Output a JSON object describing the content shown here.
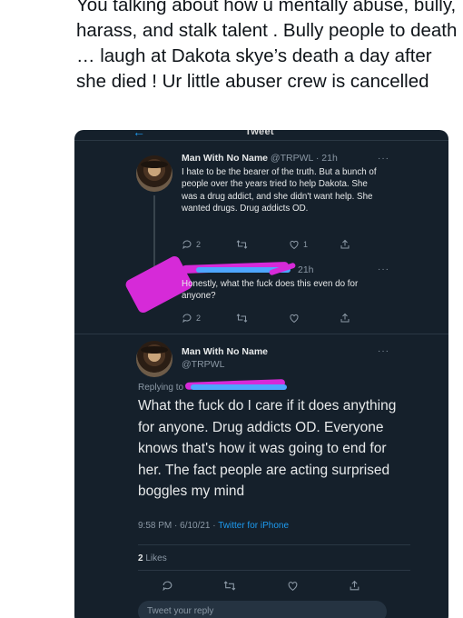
{
  "caption": {
    "text": "You talking about how u mentally abuse, bully, harass, and stalk talent . Bully people to death … laugh at Dakota skye’s death a day after she died ! Ur little abuser crew is cancelled"
  },
  "screenshot": {
    "header_title": "Tweet",
    "tweet1": {
      "name": "Man With No Name",
      "meta": "@TRPWL · 21h",
      "body": "I hate to be the bearer of the truth. But a bunch of people over the years tried to help Dakota. She was a drug addict, and she didn't want help. She wanted drugs. Drug addicts OD.",
      "reply_count": "2",
      "like_count": "1"
    },
    "tweet2": {
      "meta": "21h",
      "body": "Honestly, what the fuck does this even do for anyone?",
      "reply_count": "2"
    },
    "tweet3": {
      "name": "Man With No Name",
      "handle": "@TRPWL",
      "replying_prefix": "Replying to",
      "body": "What the fuck do I care if it does anything for anyone. Drug addicts OD. Everyone knows that's how it was going to end for her. The fact people are acting surprised boggles my mind",
      "timestamp": "9:58 PM · 6/10/21 · ",
      "app": "Twitter for iPhone",
      "likes_count": "2",
      "likes_label": "Likes"
    },
    "reply_placeholder": "Tweet your reply",
    "icons": [
      "back-arrow-icon",
      "more-icon",
      "reply-icon",
      "retweet-icon",
      "like-icon",
      "share-icon"
    ],
    "colors": {
      "background": "#15202b",
      "accent": "#1d9bf0",
      "text": "#e7e9ea",
      "muted": "#8b98a5",
      "redaction_pink": "#d62ad8",
      "redaction_blue": "#4ea6ff"
    }
  }
}
